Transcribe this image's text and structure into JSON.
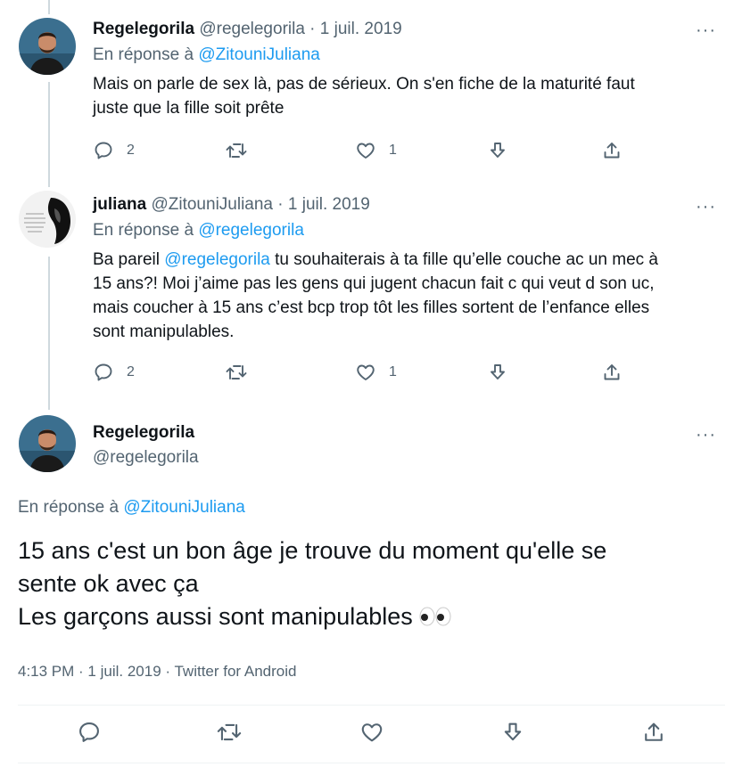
{
  "tweets": [
    {
      "name": "Regelegorila",
      "handle": "@regelegorila",
      "date": "1 juil. 2019",
      "reply_prefix": "En réponse à",
      "reply_to": "@ZitouniJuliana",
      "text_lines": [
        "Mais on parle de sex là, pas de sérieux. On s'en fiche de la maturité faut",
        "juste que la fille soit prête"
      ],
      "reply_count": "2",
      "like_count": "1"
    },
    {
      "name": "juliana",
      "handle": "@ZitouniJuliana",
      "date": "1 juil. 2019",
      "reply_prefix": "En réponse à",
      "reply_to": "@regelegorila",
      "text_before_mention": "Ba pareil ",
      "text_mention": "@regelegorila",
      "text_after_mention": " tu souhaiterais à ta fille qu’elle couche ac un mec à",
      "text_lines": [
        "15 ans?! Moi j’aime pas les gens qui jugent chacun fait c qui veut d son uc,",
        "mais coucher à 15 ans c’est bcp trop tôt les filles sortent de l’enfance elles",
        "sont manipulables."
      ],
      "reply_count": "2",
      "like_count": "1"
    }
  ],
  "main_tweet": {
    "name": "Regelegorila",
    "handle": "@regelegorila",
    "reply_prefix": "En réponse à",
    "reply_to": "@ZitouniJuliana",
    "text_lines": [
      "15 ans c'est un bon âge je trouve du moment qu'elle se",
      "sente ok avec ça",
      "Les garçons aussi sont manipulables"
    ],
    "emoji": "eyes-emoji",
    "time": "4:13 PM",
    "date": "1 juil. 2019",
    "source": "Twitter for Android"
  },
  "separator": " · ",
  "more_label": "···",
  "colors": {
    "text": "#0f1419",
    "muted": "#536471",
    "link": "#1d9bf0",
    "thread_line": "#cfd9de"
  },
  "icons": [
    "reply-icon",
    "retweet-icon",
    "like-icon",
    "bookmark-icon",
    "share-icon",
    "more-icon"
  ]
}
